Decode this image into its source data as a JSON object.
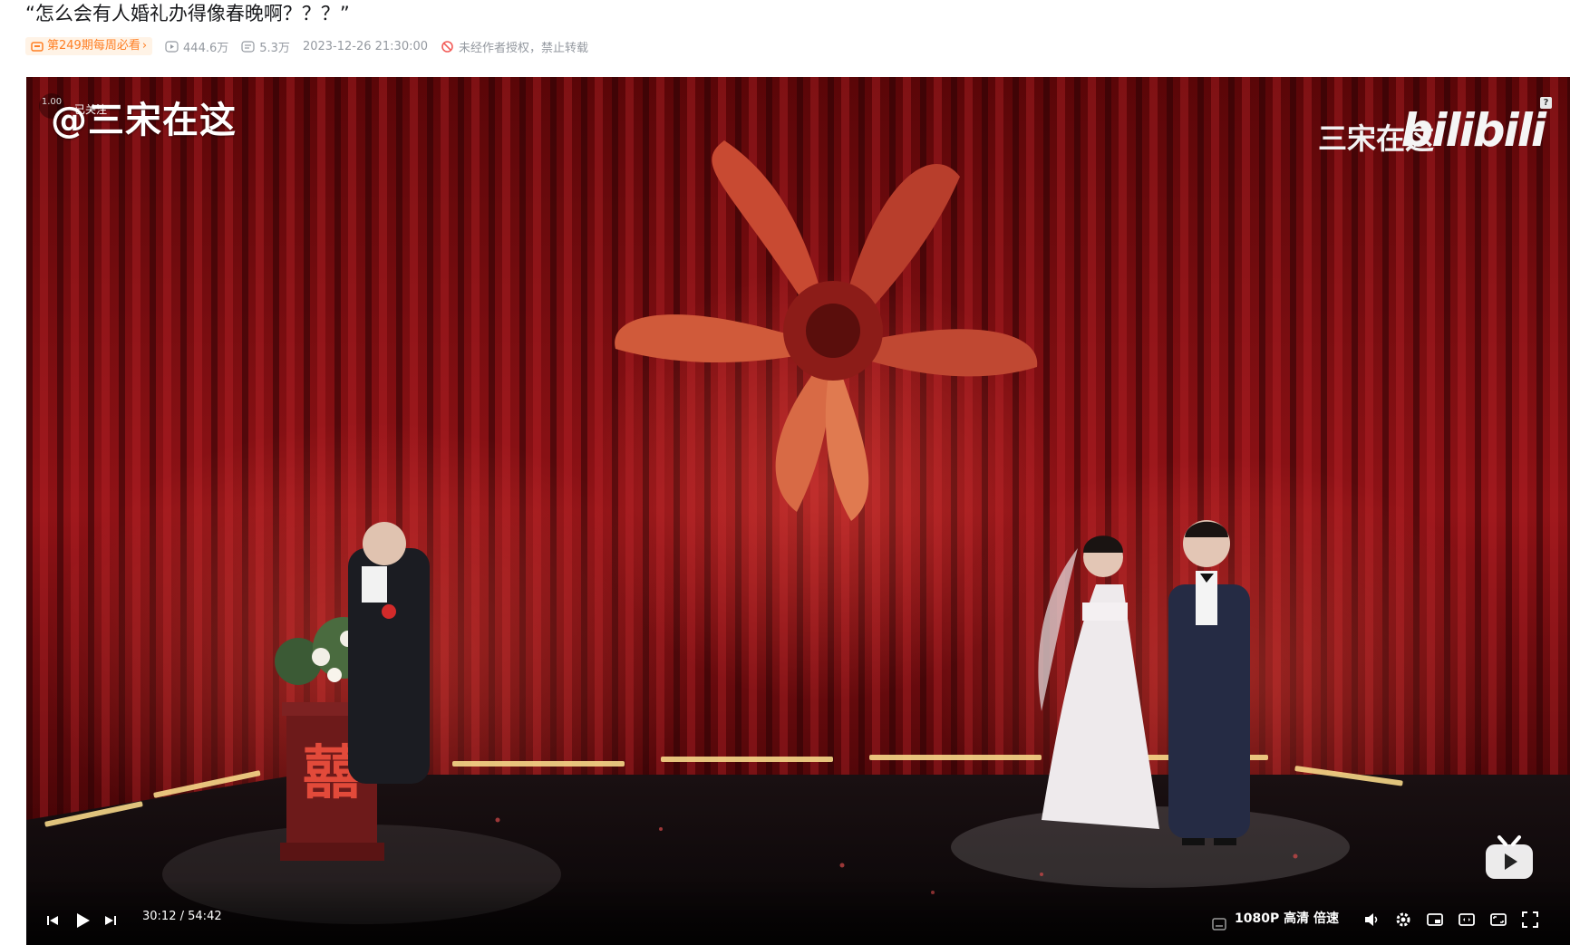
{
  "video": {
    "title": "“怎么会有人婚礼办得像春晚啊？？？”",
    "weekly_badge": "第249期每周必看",
    "weekly_chevron": "›",
    "views": "444.6万",
    "danmaku": "5.3万",
    "published": "2023-12-26 21:30:00",
    "copyright_notice": "未经作者授权，禁止转载"
  },
  "overlay": {
    "uploader_rate": "1.00",
    "followed_label": "已关注",
    "watermark_left": "@三宋在这",
    "watermark_right": "三宋在这",
    "platform_logo": "bilibili",
    "help_badge": "?"
  },
  "controls": {
    "current_time": "30:12",
    "separator": "/",
    "duration": "54:42",
    "quality": "1080P 高清",
    "speed_label": "倍速",
    "icons": [
      "prev-icon",
      "play-icon",
      "next-icon",
      "subtitle-icon",
      "volume-icon",
      "settings-icon",
      "pip-icon",
      "widescreen-icon",
      "web-fullscreen-icon",
      "fullscreen-icon"
    ]
  },
  "colors": {
    "accent": "#ff7f24",
    "curtain": "#7a0c10",
    "meta_text": "#9499a0"
  }
}
